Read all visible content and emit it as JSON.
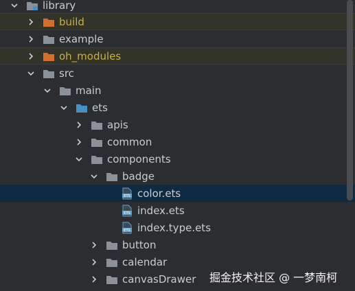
{
  "colors": {
    "background": "#2b2d30",
    "selected_row": "#0f2b44",
    "ignored_text": "#c7b23c",
    "folder_gray": "#8a9199",
    "folder_orange": "#d1702c",
    "folder_blue": "#4a8fc2",
    "ets_file": "#6a9fc6"
  },
  "tree": {
    "root": {
      "label": "library",
      "icon": "module-folder-icon"
    },
    "items": [
      {
        "label": "build",
        "icon": "excluded-folder-icon"
      },
      {
        "label": "example",
        "icon": "folder-icon"
      },
      {
        "label": "oh_modules",
        "icon": "excluded-folder-icon"
      },
      {
        "label": "src",
        "icon": "folder-icon"
      },
      {
        "label": "main",
        "icon": "folder-icon"
      },
      {
        "label": "ets",
        "icon": "source-folder-icon"
      },
      {
        "label": "apis",
        "icon": "folder-icon"
      },
      {
        "label": "common",
        "icon": "folder-icon"
      },
      {
        "label": "components",
        "icon": "folder-icon"
      },
      {
        "label": "badge",
        "icon": "folder-icon"
      },
      {
        "label": "color.ets",
        "icon": "ets-file-icon"
      },
      {
        "label": "index.ets",
        "icon": "ets-file-icon"
      },
      {
        "label": "index.type.ets",
        "icon": "ets-file-icon"
      },
      {
        "label": "button",
        "icon": "folder-icon"
      },
      {
        "label": "calendar",
        "icon": "folder-icon"
      },
      {
        "label": "canvasDrawer",
        "icon": "folder-icon"
      }
    ]
  },
  "watermark": "掘金技术社区 @ 一梦南柯"
}
